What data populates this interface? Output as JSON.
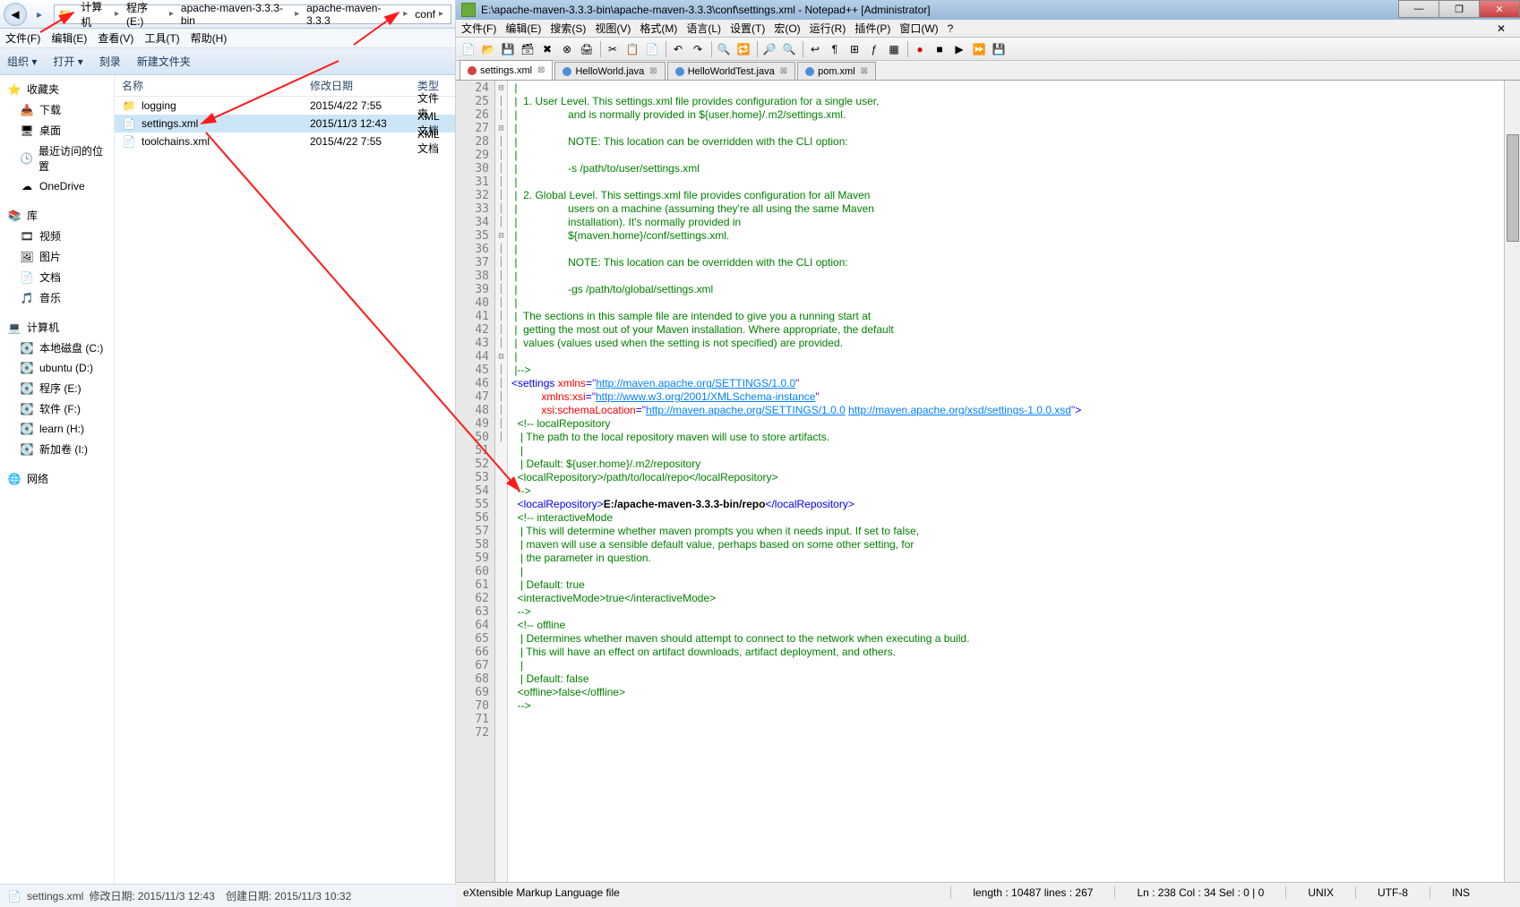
{
  "explorer": {
    "breadcrumb": [
      "计算机",
      "程序 (E:)",
      "apache-maven-3.3.3-bin",
      "apache-maven-3.3.3",
      "conf"
    ],
    "menu": [
      "文件(F)",
      "编辑(E)",
      "查看(V)",
      "工具(T)",
      "帮助(H)"
    ],
    "cmd": {
      "org": "组织 ▾",
      "open": "打开 ▾",
      "burn": "刻录",
      "newf": "新建文件夹"
    },
    "cols": {
      "name": "名称",
      "date": "修改日期",
      "type": "类型"
    },
    "nav": {
      "fav": "收藏夹",
      "dl": "下载",
      "desk": "桌面",
      "recent": "最近访问的位置",
      "od": "OneDrive",
      "lib": "库",
      "vid": "视频",
      "pic": "图片",
      "doc": "文档",
      "mus": "音乐",
      "comp": "计算机",
      "c": "本地磁盘 (C:)",
      "d": "ubuntu (D:)",
      "e": "程序 (E:)",
      "f": "软件 (F:)",
      "h": "learn (H:)",
      "i": "新加卷 (I:)",
      "net": "网络"
    },
    "files": [
      {
        "name": "logging",
        "date": "2015/4/22 7:55",
        "type": "文件夹",
        "icon": "📁"
      },
      {
        "name": "settings.xml",
        "date": "2015/11/3 12:43",
        "type": "XML 文档",
        "icon": "📄"
      },
      {
        "name": "toolchains.xml",
        "date": "2015/4/22 7:55",
        "type": "XML 文档",
        "icon": "📄"
      }
    ],
    "status": {
      "file": "settings.xml",
      "mod_lbl": "修改日期:",
      "mod": "2015/11/3 12:43",
      "crt_lbl": "创建日期:",
      "crt": "2015/11/3 10:32"
    }
  },
  "npp": {
    "title": "E:\\apache-maven-3.3.3-bin\\apache-maven-3.3.3\\conf\\settings.xml - Notepad++ [Administrator]",
    "menu": [
      "文件(F)",
      "编辑(E)",
      "搜索(S)",
      "视图(V)",
      "格式(M)",
      "语言(L)",
      "设置(T)",
      "宏(O)",
      "运行(R)",
      "插件(P)",
      "窗口(W)",
      "?"
    ],
    "tabs": [
      {
        "label": "settings.xml",
        "active": true,
        "dirty": true
      },
      {
        "label": "HelloWorld.java",
        "active": false,
        "dirty": false
      },
      {
        "label": "HelloWorldTest.java",
        "active": false,
        "dirty": false
      },
      {
        "label": "pom.xml",
        "active": false,
        "dirty": false
      }
    ],
    "status": {
      "lang": "eXtensible Markup Language file",
      "len": "length : 10487    lines : 267",
      "pos": "Ln : 238    Col : 34    Sel : 0 | 0",
      "eol": "UNIX",
      "enc": "UTF-8",
      "mode": "INS"
    },
    "code_lines": [
      {
        "n": 24,
        "t": " |",
        "cls": "c-comment"
      },
      {
        "n": 25,
        "t": " |  1. User Level. This settings.xml file provides configuration for a single user,",
        "cls": "c-comment"
      },
      {
        "n": 26,
        "t": " |                 and is normally provided in ${user.home}/.m2/settings.xml.",
        "cls": "c-comment"
      },
      {
        "n": 27,
        "t": " |",
        "cls": "c-comment"
      },
      {
        "n": 28,
        "t": " |                 NOTE: This location can be overridden with the CLI option:",
        "cls": "c-comment"
      },
      {
        "n": 29,
        "t": " |",
        "cls": "c-comment"
      },
      {
        "n": 30,
        "t": " |                 -s /path/to/user/settings.xml",
        "cls": "c-comment"
      },
      {
        "n": 31,
        "t": " |",
        "cls": "c-comment"
      },
      {
        "n": 32,
        "t": " |  2. Global Level. This settings.xml file provides configuration for all Maven",
        "cls": "c-comment"
      },
      {
        "n": 33,
        "t": " |                 users on a machine (assuming they're all using the same Maven",
        "cls": "c-comment"
      },
      {
        "n": 34,
        "t": " |                 installation). It's normally provided in",
        "cls": "c-comment"
      },
      {
        "n": 35,
        "t": " |                 ${maven.home}/conf/settings.xml.",
        "cls": "c-comment"
      },
      {
        "n": 36,
        "t": " |",
        "cls": "c-comment"
      },
      {
        "n": 37,
        "t": " |                 NOTE: This location can be overridden with the CLI option:",
        "cls": "c-comment"
      },
      {
        "n": 38,
        "t": " |",
        "cls": "c-comment"
      },
      {
        "n": 39,
        "t": " |                 -gs /path/to/global/settings.xml",
        "cls": "c-comment"
      },
      {
        "n": 40,
        "t": " |",
        "cls": "c-comment"
      },
      {
        "n": 41,
        "t": " |  The sections in this sample file are intended to give you a running start at",
        "cls": "c-comment"
      },
      {
        "n": 42,
        "t": " |  getting the most out of your Maven installation. Where appropriate, the default",
        "cls": "c-comment"
      },
      {
        "n": 43,
        "t": " |  values (values used when the setting is not specified) are provided.",
        "cls": "c-comment"
      },
      {
        "n": 44,
        "t": " |",
        "cls": "c-comment"
      },
      {
        "n": 45,
        "t": " |-->",
        "cls": "c-comment"
      },
      {
        "n": 46,
        "html": "<span class='c-tag'>&lt;settings</span> <span class='c-attr'>xmlns</span><span class='c-tag'>=</span><span class='c-str'>\"</span><span class='c-url'>http://maven.apache.org/SETTINGS/1.0.0</span><span class='c-str'>\"</span>",
        "f": "⊟"
      },
      {
        "n": 47,
        "html": "          <span class='c-attr'>xmlns:xsi</span><span class='c-tag'>=</span><span class='c-str'>\"</span><span class='c-url'>http://www.w3.org/2001/XMLSchema-instance</span><span class='c-str'>\"</span>",
        "f": "│"
      },
      {
        "n": 48,
        "html": "          <span class='c-attr'>xsi:schemaLocation</span><span class='c-tag'>=</span><span class='c-str'>\"</span><span class='c-url'>http://maven.apache.org/SETTINGS/1.0.0</span> <span class='c-url'>http://maven.apache.org/xsd/settings-1.0.0.xsd</span><span class='c-str'>\"</span><span class='c-tag'>&gt;</span>",
        "f": "│"
      },
      {
        "n": 49,
        "html": "  <span class='c-comment'>&lt;!-- localRepository</span>",
        "f": "⊟"
      },
      {
        "n": 50,
        "t": "   | The path to the local repository maven will use to store artifacts.",
        "cls": "c-comment",
        "f": "│"
      },
      {
        "n": 51,
        "t": "   |",
        "cls": "c-comment",
        "f": "│"
      },
      {
        "n": 52,
        "t": "   | Default: ${user.home}/.m2/repository",
        "cls": "c-comment",
        "f": "│"
      },
      {
        "n": 53,
        "t": "  <localRepository>/path/to/local/repo</localRepository>",
        "cls": "c-comment",
        "f": "│"
      },
      {
        "n": 54,
        "t": "  -->",
        "cls": "c-comment",
        "f": "│"
      },
      {
        "n": 55,
        "html": "  <span class='c-tag'>&lt;localRepository&gt;</span><span class='c-text'>E:/apache-maven-3.3.3-bin/repo</span><span class='c-tag'>&lt;/localRepository&gt;</span>",
        "f": "│"
      },
      {
        "n": 56,
        "t": "",
        "f": "│"
      },
      {
        "n": 57,
        "html": "  <span class='c-comment'>&lt;!-- interactiveMode</span>",
        "f": "⊟"
      },
      {
        "n": 58,
        "t": "   | This will determine whether maven prompts you when it needs input. If set to false,",
        "cls": "c-comment",
        "f": "│"
      },
      {
        "n": 59,
        "t": "   | maven will use a sensible default value, perhaps based on some other setting, for",
        "cls": "c-comment",
        "f": "│"
      },
      {
        "n": 60,
        "t": "   | the parameter in question.",
        "cls": "c-comment",
        "f": "│"
      },
      {
        "n": 61,
        "t": "   |",
        "cls": "c-comment",
        "f": "│"
      },
      {
        "n": 62,
        "t": "   | Default: true",
        "cls": "c-comment",
        "f": "│"
      },
      {
        "n": 63,
        "t": "  <interactiveMode>true</interactiveMode>",
        "cls": "c-comment",
        "f": "│"
      },
      {
        "n": 64,
        "t": "  -->",
        "cls": "c-comment",
        "f": "│"
      },
      {
        "n": 65,
        "t": "",
        "f": "│"
      },
      {
        "n": 66,
        "html": "  <span class='c-comment'>&lt;!-- offline</span>",
        "f": "⊟"
      },
      {
        "n": 67,
        "t": "   | Determines whether maven should attempt to connect to the network when executing a build.",
        "cls": "c-comment",
        "f": "│"
      },
      {
        "n": 68,
        "t": "   | This will have an effect on artifact downloads, artifact deployment, and others.",
        "cls": "c-comment",
        "f": "│"
      },
      {
        "n": 69,
        "t": "   |",
        "cls": "c-comment",
        "f": "│"
      },
      {
        "n": 70,
        "t": "   | Default: false",
        "cls": "c-comment",
        "f": "│"
      },
      {
        "n": 71,
        "t": "  <offline>false</offline>",
        "cls": "c-comment",
        "f": "│"
      },
      {
        "n": 72,
        "t": "  -->",
        "cls": "c-comment",
        "f": "│"
      }
    ]
  }
}
